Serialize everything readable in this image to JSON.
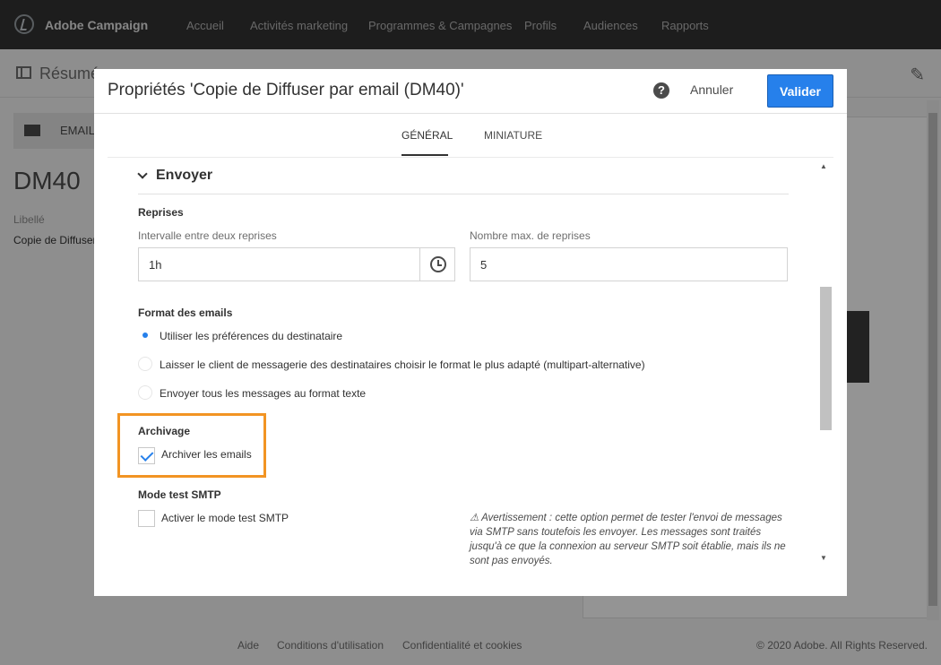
{
  "app": {
    "brand": "Adobe Campaign",
    "nav": [
      "Accueil",
      "Activités marketing",
      "Programmes & Campagnes",
      "Profils",
      "Audiences",
      "Rapports"
    ]
  },
  "background": {
    "summary_title": "Résumé",
    "email_tab": "EMAIL",
    "dm_code": "DM40",
    "libelle_label": "Libellé",
    "libelle_value": "Copie de Diffuser",
    "footer_links": [
      "Aide",
      "Conditions d'utilisation",
      "Confidentialité et cookies"
    ],
    "copyright": "© 2020 Adobe. All Rights Reserved."
  },
  "dialog": {
    "title": "Propriétés 'Copie de Diffuser par email (DM40)'",
    "help_icon": "question-icon",
    "cancel_label": "Annuler",
    "validate_label": "Valider",
    "tabs": [
      "GÉNÉRAL",
      "MINIATURE"
    ],
    "active_tab": "GÉNÉRAL",
    "section_title": "Envoyer",
    "retries": {
      "heading": "Reprises",
      "interval_label": "Intervalle entre deux reprises",
      "interval_value": "1h",
      "max_label": "Nombre max. de reprises",
      "max_value": "5"
    },
    "email_format": {
      "heading": "Format des emails",
      "options": [
        "Utiliser les préférences du destinataire",
        "Laisser le client de messagerie des destinataires choisir le format le plus adapté (multipart-alternative)",
        "Envoyer tous les messages au format texte"
      ],
      "selected_index": 0
    },
    "archiving": {
      "heading": "Archivage",
      "checkbox_label": "Archiver les emails",
      "checked": true
    },
    "smtp_test": {
      "heading": "Mode test SMTP",
      "checkbox_label": "Activer le mode test SMTP",
      "checked": false,
      "warning": "⚠ Avertissement : cette option permet de tester l'envoi de messages via SMTP sans toutefois les envoyer. Les messages sont traités jusqu'à ce que la connexion au serveur SMTP soit établie, mais ils ne sont pas envoyés."
    }
  },
  "colors": {
    "topnav": "#323232",
    "accent": "#2680eb",
    "highlight": "#f29423"
  }
}
